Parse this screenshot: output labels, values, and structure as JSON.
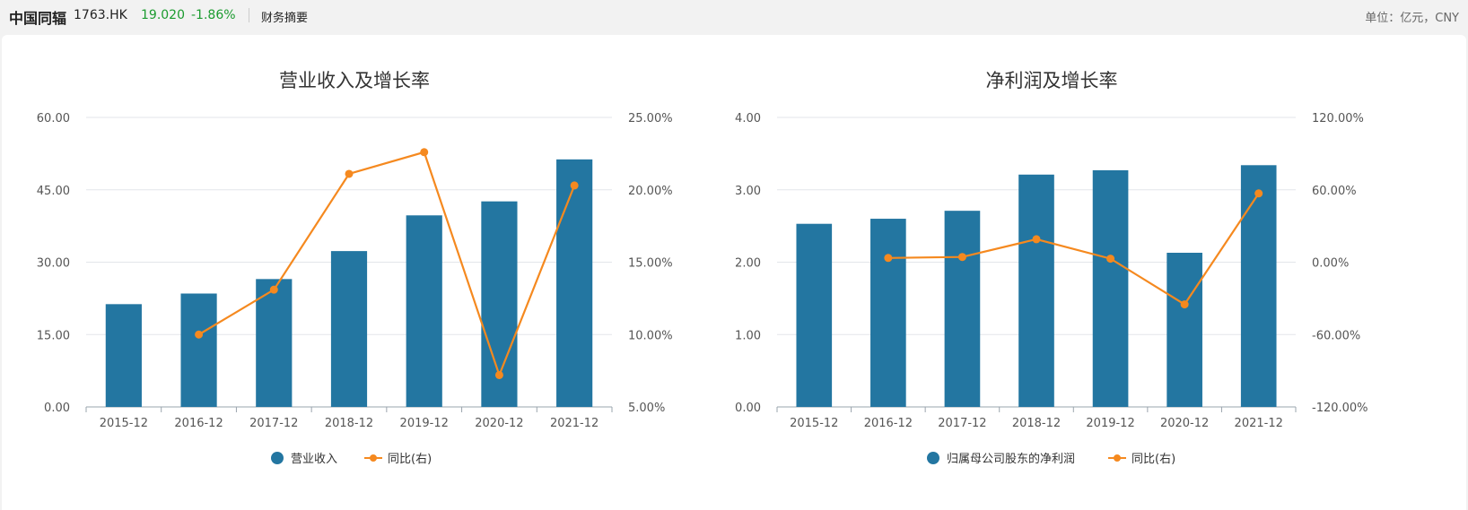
{
  "header": {
    "stock_name": "中国同辐",
    "stock_code": "1763.HK",
    "price": "19.020",
    "change": "-1.86%",
    "section": "财务摘要",
    "unit": "单位：亿元，CNY"
  },
  "colors": {
    "bar": "#2376a1",
    "line": "#f5891f"
  },
  "chart_data": [
    {
      "type": "bar",
      "title": "营业收入及增长率",
      "categories": [
        "2015-12",
        "2016-12",
        "2017-12",
        "2018-12",
        "2019-12",
        "2020-12",
        "2021-12"
      ],
      "left_ticks": [
        "0.00",
        "15.00",
        "30.00",
        "45.00",
        "60.00"
      ],
      "right_ticks": [
        "5.00%",
        "10.00%",
        "15.00%",
        "20.00%",
        "25.00%"
      ],
      "ylim_left": [
        0,
        60
      ],
      "ylim_right": [
        5,
        25
      ],
      "series": [
        {
          "name": "营业收入",
          "type": "bar",
          "axis": "left",
          "values": [
            21.3,
            23.5,
            26.5,
            32.3,
            39.7,
            42.6,
            51.3
          ]
        },
        {
          "name": "同比(右)",
          "type": "line",
          "axis": "right",
          "values": [
            null,
            10.0,
            13.1,
            21.1,
            22.6,
            7.2,
            20.3
          ]
        }
      ]
    },
    {
      "type": "bar",
      "title": "净利润及增长率",
      "categories": [
        "2015-12",
        "2016-12",
        "2017-12",
        "2018-12",
        "2019-12",
        "2020-12",
        "2021-12"
      ],
      "left_ticks": [
        "0.00",
        "1.00",
        "2.00",
        "3.00",
        "4.00"
      ],
      "right_ticks": [
        "-120.00%",
        "-60.00%",
        "0.00%",
        "60.00%",
        "120.00%"
      ],
      "ylim_left": [
        0,
        4
      ],
      "ylim_right": [
        -120,
        120
      ],
      "series": [
        {
          "name": "归属母公司股东的净利润",
          "type": "bar",
          "axis": "left",
          "values": [
            2.53,
            2.6,
            2.71,
            3.21,
            3.27,
            2.13,
            3.34
          ]
        },
        {
          "name": "同比(右)",
          "type": "line",
          "axis": "right",
          "values": [
            null,
            3.5,
            4.3,
            19.0,
            2.9,
            -35.0,
            57.0
          ]
        }
      ]
    }
  ]
}
